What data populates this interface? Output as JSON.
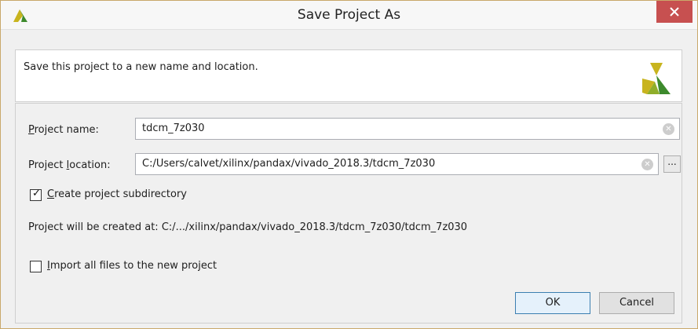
{
  "window": {
    "title": "Save Project As"
  },
  "header": {
    "description": "Save this project to a new name and location."
  },
  "form": {
    "project_name": {
      "label_prefix": "P",
      "label_rest": "roject name:",
      "value": "tdcm_7z030"
    },
    "project_location": {
      "label_prefix": "Project ",
      "label_underlined": "l",
      "label_rest": "ocation:",
      "value": "C:/Users/calvet/xilinx/pandax/vivado_2018.3/tdcm_7z030",
      "browse_label": "..."
    },
    "create_subdir": {
      "checked": true,
      "label_underlined": "C",
      "label_rest": "reate project subdirectory"
    },
    "created_at_text": "Project will be created at: C:/.../xilinx/pandax/vivado_2018.3/tdcm_7z030/tdcm_7z030",
    "import_files": {
      "checked": false,
      "label_underlined": "I",
      "label_rest": "mport all files to the new project"
    }
  },
  "buttons": {
    "ok": "OK",
    "cancel": "Cancel"
  },
  "icons": {
    "app": "vivado-logo-icon",
    "close": "close-icon",
    "clear": "clear-icon",
    "check": "checkmark-icon"
  },
  "colors": {
    "close_bg": "#c75050",
    "logo_yellow": "#c8b41e",
    "logo_green": "#3d8a2c",
    "ok_border": "#3c7fb1"
  }
}
